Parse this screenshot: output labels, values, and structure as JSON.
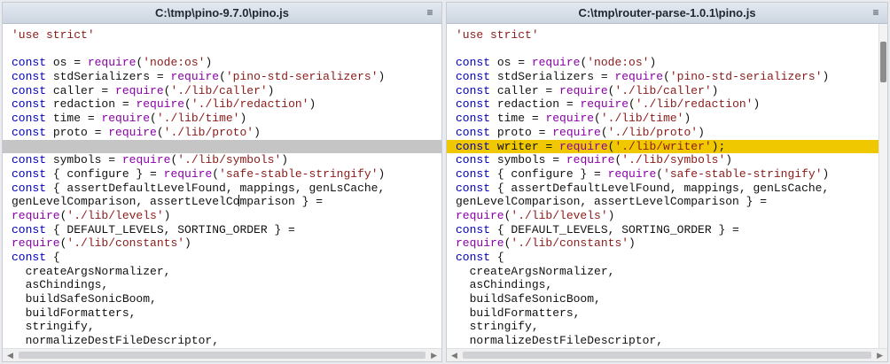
{
  "left": {
    "title": "C:\\tmp\\pino-9.7.0\\pino.js",
    "lines": [
      {
        "type": "normal",
        "tokens": [
          {
            "t": "str",
            "v": "'use strict'"
          }
        ]
      },
      {
        "type": "normal",
        "tokens": []
      },
      {
        "type": "normal",
        "tokens": [
          {
            "t": "kw",
            "v": "const"
          },
          {
            "t": "txt",
            "v": " os = "
          },
          {
            "t": "fn",
            "v": "require"
          },
          {
            "t": "txt",
            "v": "("
          },
          {
            "t": "str",
            "v": "'node:os'"
          },
          {
            "t": "txt",
            "v": ")"
          }
        ]
      },
      {
        "type": "normal",
        "tokens": [
          {
            "t": "kw",
            "v": "const"
          },
          {
            "t": "txt",
            "v": " stdSerializers = "
          },
          {
            "t": "fn",
            "v": "require"
          },
          {
            "t": "txt",
            "v": "("
          },
          {
            "t": "str",
            "v": "'pino-std-serializers'"
          },
          {
            "t": "txt",
            "v": ")"
          }
        ]
      },
      {
        "type": "normal",
        "tokens": [
          {
            "t": "kw",
            "v": "const"
          },
          {
            "t": "txt",
            "v": " caller = "
          },
          {
            "t": "fn",
            "v": "require"
          },
          {
            "t": "txt",
            "v": "("
          },
          {
            "t": "str",
            "v": "'./lib/caller'"
          },
          {
            "t": "txt",
            "v": ")"
          }
        ]
      },
      {
        "type": "normal",
        "tokens": [
          {
            "t": "kw",
            "v": "const"
          },
          {
            "t": "txt",
            "v": " redaction = "
          },
          {
            "t": "fn",
            "v": "require"
          },
          {
            "t": "txt",
            "v": "("
          },
          {
            "t": "str",
            "v": "'./lib/redaction'"
          },
          {
            "t": "txt",
            "v": ")"
          }
        ]
      },
      {
        "type": "normal",
        "tokens": [
          {
            "t": "kw",
            "v": "const"
          },
          {
            "t": "txt",
            "v": " time = "
          },
          {
            "t": "fn",
            "v": "require"
          },
          {
            "t": "txt",
            "v": "("
          },
          {
            "t": "str",
            "v": "'./lib/time'"
          },
          {
            "t": "txt",
            "v": ")"
          }
        ]
      },
      {
        "type": "normal",
        "tokens": [
          {
            "t": "kw",
            "v": "const"
          },
          {
            "t": "txt",
            "v": " proto = "
          },
          {
            "t": "fn",
            "v": "require"
          },
          {
            "t": "txt",
            "v": "("
          },
          {
            "t": "str",
            "v": "'./lib/proto'"
          },
          {
            "t": "txt",
            "v": ")"
          }
        ]
      },
      {
        "type": "blank-gap",
        "tokens": []
      },
      {
        "type": "normal",
        "tokens": [
          {
            "t": "kw",
            "v": "const"
          },
          {
            "t": "txt",
            "v": " symbols = "
          },
          {
            "t": "fn",
            "v": "require"
          },
          {
            "t": "txt",
            "v": "("
          },
          {
            "t": "str",
            "v": "'./lib/symbols'"
          },
          {
            "t": "txt",
            "v": ")"
          }
        ]
      },
      {
        "type": "normal",
        "tokens": [
          {
            "t": "kw",
            "v": "const"
          },
          {
            "t": "txt",
            "v": " { configure } = "
          },
          {
            "t": "fn",
            "v": "require"
          },
          {
            "t": "txt",
            "v": "("
          },
          {
            "t": "str",
            "v": "'safe-stable-stringify'"
          },
          {
            "t": "txt",
            "v": ")"
          }
        ]
      },
      {
        "type": "normal",
        "tokens": [
          {
            "t": "kw",
            "v": "const"
          },
          {
            "t": "txt",
            "v": " { assertDefaultLevelFound, mappings, genLsCache,"
          }
        ]
      },
      {
        "type": "normal",
        "tokens": [
          {
            "t": "txt",
            "v": "genLevelComparison, assertLevelCo"
          },
          {
            "t": "caret",
            "v": ""
          },
          {
            "t": "txt",
            "v": "mparison } ="
          }
        ]
      },
      {
        "type": "normal",
        "tokens": [
          {
            "t": "fn",
            "v": "require"
          },
          {
            "t": "txt",
            "v": "("
          },
          {
            "t": "str",
            "v": "'./lib/levels'"
          },
          {
            "t": "txt",
            "v": ")"
          }
        ]
      },
      {
        "type": "normal",
        "tokens": [
          {
            "t": "kw",
            "v": "const"
          },
          {
            "t": "txt",
            "v": " { DEFAULT_LEVELS, SORTING_ORDER } ="
          }
        ]
      },
      {
        "type": "normal",
        "tokens": [
          {
            "t": "fn",
            "v": "require"
          },
          {
            "t": "txt",
            "v": "("
          },
          {
            "t": "str",
            "v": "'./lib/constants'"
          },
          {
            "t": "txt",
            "v": ")"
          }
        ]
      },
      {
        "type": "normal",
        "tokens": [
          {
            "t": "kw",
            "v": "const"
          },
          {
            "t": "txt",
            "v": " {"
          }
        ]
      },
      {
        "type": "normal",
        "tokens": [
          {
            "t": "txt",
            "v": "  createArgsNormalizer,"
          }
        ]
      },
      {
        "type": "normal",
        "tokens": [
          {
            "t": "txt",
            "v": "  asChindings,"
          }
        ]
      },
      {
        "type": "normal",
        "tokens": [
          {
            "t": "txt",
            "v": "  buildSafeSonicBoom,"
          }
        ]
      },
      {
        "type": "normal",
        "tokens": [
          {
            "t": "txt",
            "v": "  buildFormatters,"
          }
        ]
      },
      {
        "type": "normal",
        "tokens": [
          {
            "t": "txt",
            "v": "  stringify,"
          }
        ]
      },
      {
        "type": "normal",
        "tokens": [
          {
            "t": "txt",
            "v": "  normalizeDestFileDescriptor,"
          }
        ]
      }
    ]
  },
  "right": {
    "title": "C:\\tmp\\router-parse-1.0.1\\pino.js",
    "lines": [
      {
        "type": "normal",
        "tokens": [
          {
            "t": "str",
            "v": "'use strict'"
          }
        ]
      },
      {
        "type": "normal",
        "tokens": []
      },
      {
        "type": "normal",
        "tokens": [
          {
            "t": "kw",
            "v": "const"
          },
          {
            "t": "txt",
            "v": " os = "
          },
          {
            "t": "fn",
            "v": "require"
          },
          {
            "t": "txt",
            "v": "("
          },
          {
            "t": "str",
            "v": "'node:os'"
          },
          {
            "t": "txt",
            "v": ")"
          }
        ]
      },
      {
        "type": "normal",
        "tokens": [
          {
            "t": "kw",
            "v": "const"
          },
          {
            "t": "txt",
            "v": " stdSerializers = "
          },
          {
            "t": "fn",
            "v": "require"
          },
          {
            "t": "txt",
            "v": "("
          },
          {
            "t": "str",
            "v": "'pino-std-serializers'"
          },
          {
            "t": "txt",
            "v": ")"
          }
        ]
      },
      {
        "type": "normal",
        "tokens": [
          {
            "t": "kw",
            "v": "const"
          },
          {
            "t": "txt",
            "v": " caller = "
          },
          {
            "t": "fn",
            "v": "require"
          },
          {
            "t": "txt",
            "v": "("
          },
          {
            "t": "str",
            "v": "'./lib/caller'"
          },
          {
            "t": "txt",
            "v": ")"
          }
        ]
      },
      {
        "type": "normal",
        "tokens": [
          {
            "t": "kw",
            "v": "const"
          },
          {
            "t": "txt",
            "v": " redaction = "
          },
          {
            "t": "fn",
            "v": "require"
          },
          {
            "t": "txt",
            "v": "("
          },
          {
            "t": "str",
            "v": "'./lib/redaction'"
          },
          {
            "t": "txt",
            "v": ")"
          }
        ]
      },
      {
        "type": "normal",
        "tokens": [
          {
            "t": "kw",
            "v": "const"
          },
          {
            "t": "txt",
            "v": " time = "
          },
          {
            "t": "fn",
            "v": "require"
          },
          {
            "t": "txt",
            "v": "("
          },
          {
            "t": "str",
            "v": "'./lib/time'"
          },
          {
            "t": "txt",
            "v": ")"
          }
        ]
      },
      {
        "type": "normal",
        "tokens": [
          {
            "t": "kw",
            "v": "const"
          },
          {
            "t": "txt",
            "v": " proto = "
          },
          {
            "t": "fn",
            "v": "require"
          },
          {
            "t": "txt",
            "v": "("
          },
          {
            "t": "str",
            "v": "'./lib/proto'"
          },
          {
            "t": "txt",
            "v": ")"
          }
        ]
      },
      {
        "type": "added",
        "tokens": [
          {
            "t": "kw",
            "v": "const"
          },
          {
            "t": "txt",
            "v": " writer = "
          },
          {
            "t": "fn",
            "v": "require"
          },
          {
            "t": "txt",
            "v": "("
          },
          {
            "t": "str",
            "v": "'./lib/writer'"
          },
          {
            "t": "txt",
            "v": ");"
          }
        ]
      },
      {
        "type": "normal",
        "tokens": [
          {
            "t": "kw",
            "v": "const"
          },
          {
            "t": "txt",
            "v": " symbols = "
          },
          {
            "t": "fn",
            "v": "require"
          },
          {
            "t": "txt",
            "v": "("
          },
          {
            "t": "str",
            "v": "'./lib/symbols'"
          },
          {
            "t": "txt",
            "v": ")"
          }
        ]
      },
      {
        "type": "normal",
        "tokens": [
          {
            "t": "kw",
            "v": "const"
          },
          {
            "t": "txt",
            "v": " { configure } = "
          },
          {
            "t": "fn",
            "v": "require"
          },
          {
            "t": "txt",
            "v": "("
          },
          {
            "t": "str",
            "v": "'safe-stable-stringify'"
          },
          {
            "t": "txt",
            "v": ")"
          }
        ]
      },
      {
        "type": "normal",
        "tokens": [
          {
            "t": "kw",
            "v": "const"
          },
          {
            "t": "txt",
            "v": " { assertDefaultLevelFound, mappings, genLsCache,"
          }
        ]
      },
      {
        "type": "normal",
        "tokens": [
          {
            "t": "txt",
            "v": "genLevelComparison, assertLevelComparison } ="
          }
        ]
      },
      {
        "type": "normal",
        "tokens": [
          {
            "t": "fn",
            "v": "require"
          },
          {
            "t": "txt",
            "v": "("
          },
          {
            "t": "str",
            "v": "'./lib/levels'"
          },
          {
            "t": "txt",
            "v": ")"
          }
        ]
      },
      {
        "type": "normal",
        "tokens": [
          {
            "t": "kw",
            "v": "const"
          },
          {
            "t": "txt",
            "v": " { DEFAULT_LEVELS, SORTING_ORDER } ="
          }
        ]
      },
      {
        "type": "normal",
        "tokens": [
          {
            "t": "fn",
            "v": "require"
          },
          {
            "t": "txt",
            "v": "("
          },
          {
            "t": "str",
            "v": "'./lib/constants'"
          },
          {
            "t": "txt",
            "v": ")"
          }
        ]
      },
      {
        "type": "normal",
        "tokens": [
          {
            "t": "kw",
            "v": "const"
          },
          {
            "t": "txt",
            "v": " {"
          }
        ]
      },
      {
        "type": "normal",
        "tokens": [
          {
            "t": "txt",
            "v": "  createArgsNormalizer,"
          }
        ]
      },
      {
        "type": "normal",
        "tokens": [
          {
            "t": "txt",
            "v": "  asChindings,"
          }
        ]
      },
      {
        "type": "normal",
        "tokens": [
          {
            "t": "txt",
            "v": "  buildSafeSonicBoom,"
          }
        ]
      },
      {
        "type": "normal",
        "tokens": [
          {
            "t": "txt",
            "v": "  buildFormatters,"
          }
        ]
      },
      {
        "type": "normal",
        "tokens": [
          {
            "t": "txt",
            "v": "  stringify,"
          }
        ]
      },
      {
        "type": "normal",
        "tokens": [
          {
            "t": "txt",
            "v": "  normalizeDestFileDescriptor,"
          }
        ]
      }
    ]
  },
  "icons": {
    "menu": "≡",
    "scroll_left": "◀",
    "scroll_right": "▶"
  },
  "colors": {
    "keyword": "#0000bb",
    "function": "#8a00a8",
    "string": "#8b1a1a",
    "added_line": "#f0c800",
    "gap_line": "#c5c5c5"
  }
}
